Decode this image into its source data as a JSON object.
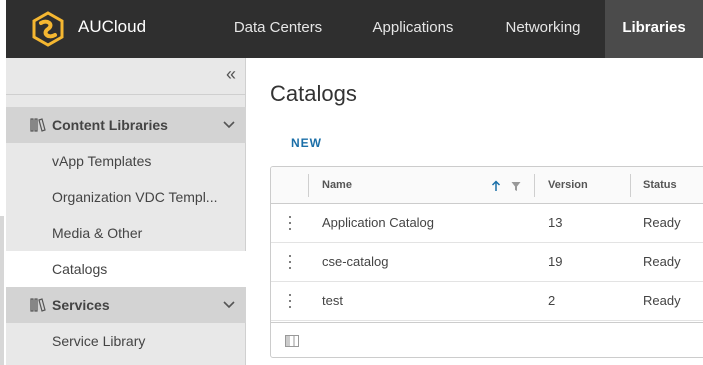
{
  "app": {
    "title": "AUCloud"
  },
  "nav": {
    "items": [
      {
        "label": "Data Centers"
      },
      {
        "label": "Applications"
      },
      {
        "label": "Networking"
      },
      {
        "label": "Libraries"
      }
    ],
    "active": "Libraries"
  },
  "sidebar": {
    "sections": [
      {
        "label": "Content Libraries",
        "items": [
          {
            "label": "vApp Templates"
          },
          {
            "label": "Organization VDC Templ..."
          },
          {
            "label": "Media & Other"
          },
          {
            "label": "Catalogs"
          }
        ]
      },
      {
        "label": "Services",
        "items": [
          {
            "label": "Service Library"
          }
        ]
      }
    ],
    "active_item": "Catalogs"
  },
  "main": {
    "title": "Catalogs",
    "new_label": "NEW",
    "grid": {
      "columns": [
        {
          "label": "Name"
        },
        {
          "label": "Version"
        },
        {
          "label": "Status"
        }
      ],
      "sort": "ascending",
      "rows": [
        {
          "name": "Application Catalog",
          "version": "13",
          "status": "Ready"
        },
        {
          "name": "cse-catalog",
          "version": "19",
          "status": "Ready"
        },
        {
          "name": "test",
          "version": "2",
          "status": "Ready"
        }
      ]
    }
  },
  "colors": {
    "header_bg": "#2f2f2f",
    "active_nav_bg": "#4b4b4b",
    "logo_accent": "#f5b731",
    "link": "#1b6fa8",
    "sidebar_bg": "#e8e8e8"
  }
}
